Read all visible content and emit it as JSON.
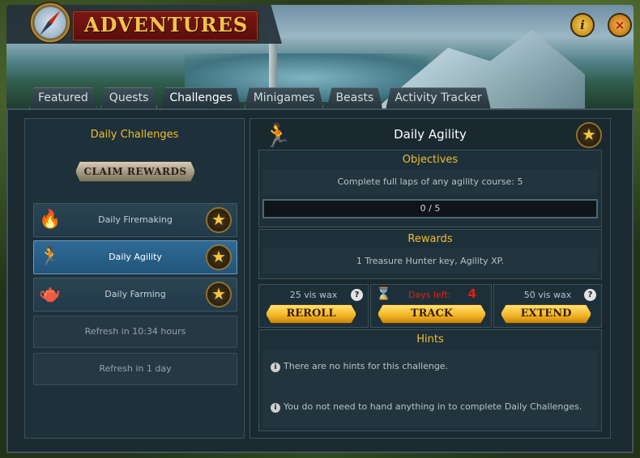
{
  "window": {
    "title": "ADVENTURES",
    "info_icon": "i",
    "close_icon": "×"
  },
  "tabs": [
    {
      "label": "Featured"
    },
    {
      "label": "Quests"
    },
    {
      "label": "Challenges"
    },
    {
      "label": "Minigames"
    },
    {
      "label": "Beasts"
    },
    {
      "label": "Activity Tracker"
    }
  ],
  "active_tab": "Challenges",
  "left": {
    "title": "Daily Challenges",
    "claim_label": "CLAIM REWARDS",
    "challenges": [
      {
        "label": "Daily Firemaking",
        "icon": "fire-icon"
      },
      {
        "label": "Daily Agility",
        "icon": "runner-icon"
      },
      {
        "label": "Daily Farming",
        "icon": "watering-can-icon"
      }
    ],
    "refresh": [
      {
        "label": "Refresh in 10:34 hours"
      },
      {
        "label": "Refresh in 1 day"
      }
    ]
  },
  "detail": {
    "title": "Daily Agility",
    "objectives": {
      "heading": "Objectives",
      "text": "Complete full laps of any agility course: 5",
      "progress": "0 / 5",
      "progress_fraction": 0
    },
    "rewards": {
      "heading": "Rewards",
      "text": "1 Treasure Hunter key, Agility XP."
    },
    "reroll": {
      "cost": "25 vis wax",
      "label": "REROLL"
    },
    "track": {
      "days_label": "Days left:",
      "days_value": "4",
      "label": "TRACK"
    },
    "extend": {
      "cost": "50 vis wax",
      "label": "EXTEND"
    },
    "hints": {
      "heading": "Hints",
      "lines": [
        "There are no hints for this challenge.",
        "You do not need to hand anything in to complete Daily Challenges."
      ]
    }
  },
  "colors": {
    "accent_gold": "#f2bd2c",
    "selected_blue": "#2f6a95",
    "days_red": "#e02010"
  }
}
